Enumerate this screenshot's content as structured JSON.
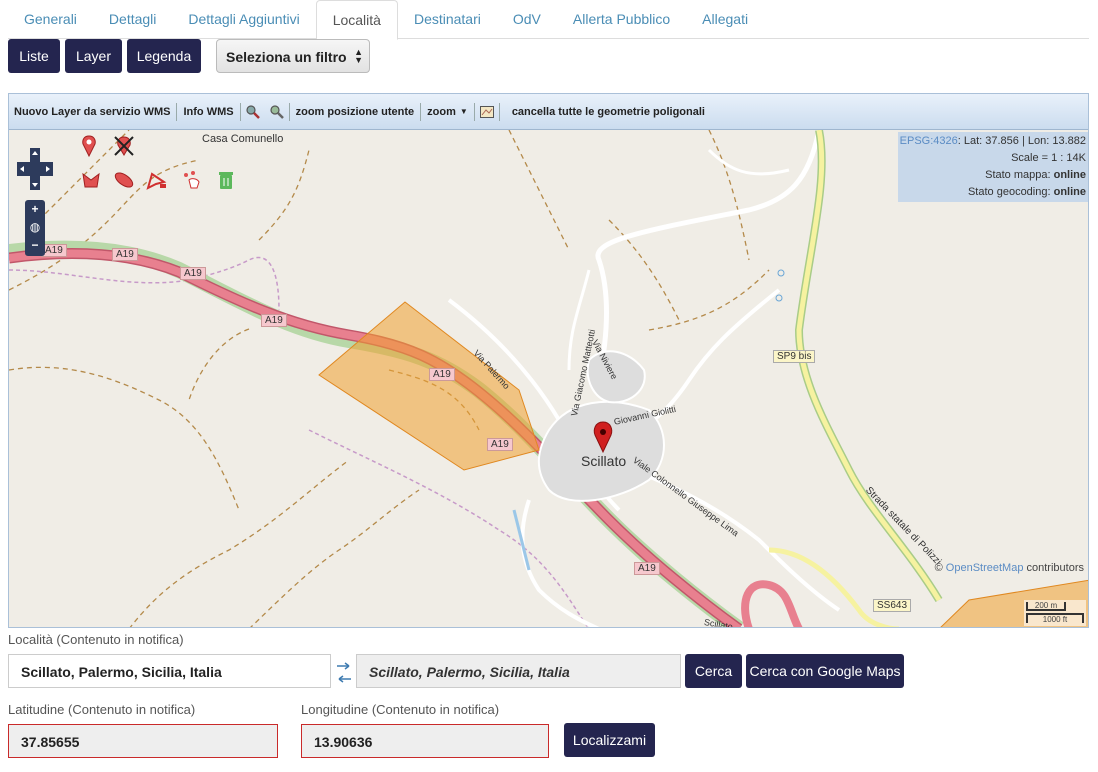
{
  "tabs": [
    {
      "label": "Generali"
    },
    {
      "label": "Dettagli"
    },
    {
      "label": "Dettagli Aggiuntivi"
    },
    {
      "label": "Località"
    },
    {
      "label": "Destinatari"
    },
    {
      "label": "OdV"
    },
    {
      "label": "Allerta Pubblico"
    },
    {
      "label": "Allegati"
    }
  ],
  "active_tab": "Località",
  "buttons": {
    "liste": "Liste",
    "layer": "Layer",
    "legenda": "Legenda"
  },
  "filter": {
    "selected": "Seleziona un filtro"
  },
  "map_toolbar": {
    "wms_layer": "Nuovo Layer da servizio WMS",
    "info_wms": "Info WMS",
    "zoom_user": "zoom posizione utente",
    "zoom": "zoom",
    "clear_polygons": "cancella tutte le geometrie poligonali"
  },
  "map_info": {
    "epsg": "EPSG:4326",
    "latlon": ": Lat: 37.856 | Lon: 13.882",
    "scale": "Scale = 1 : 14K",
    "map_status_label": "Stato mappa:",
    "map_status": "online",
    "geocoding_status_label": "Stato geocoding:",
    "geocoding_status": "online",
    "credit_prefix": "©",
    "credit_link": "OpenStreetMap",
    "credit_suffix": "contributors",
    "scale_bar_m": "200 m",
    "scale_bar_ft": "1000 ft"
  },
  "map_labels": {
    "casa": "Casa Comunello",
    "town": "Scillato",
    "a19": "A19",
    "sp9": "SP9 bis",
    "ss643": "SS643",
    "via_palermo": "Via Palermo",
    "via_matteotti": "Via Giacomo Matteotti",
    "via_niviere": "Via Niviere",
    "via_giolitti": "Giovanni Giolitti",
    "viale_colonnello": "Viale Colonnello Giuseppe Lima",
    "strada_statale": "Strada statale di Polizzi",
    "scillato_bottom": "Scillato"
  },
  "form": {
    "localita_label": "Località (Contenuto in notifica)",
    "localita_value": "Scillato, Palermo, Sicilia, Italia",
    "localita_resolved": "Scillato, Palermo, Sicilia, Italia",
    "cerca": "Cerca",
    "cerca_google": "Cerca con Google Maps",
    "lat_label": "Latitudine (Contenuto in notifica)",
    "lat_value": "37.85655",
    "lon_label": "Longitudine (Contenuto in notifica)",
    "lon_value": "13.90636",
    "localizzami": "Localizzami"
  },
  "colors": {
    "dark_button": "#24254f",
    "tab_link": "#4a8db5",
    "highway": "#e8808f",
    "polygon": "#f0a030",
    "error_border": "#c92a2a"
  }
}
